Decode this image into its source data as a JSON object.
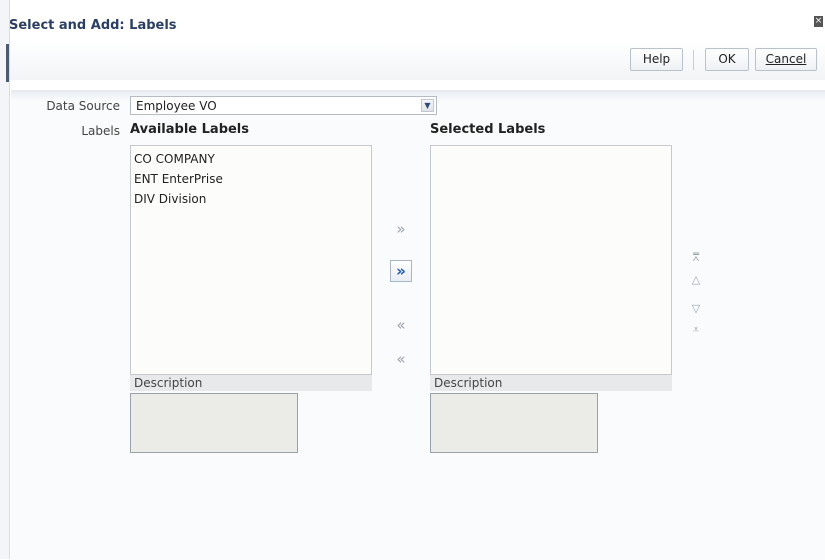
{
  "dialog": {
    "title": "Select and Add: Labels",
    "close_glyph": "×"
  },
  "toolbar": {
    "help_label": "Help",
    "ok_label": "OK",
    "cancel_label": "Cancel"
  },
  "form": {
    "data_source_label": "Data Source",
    "data_source_value": "Employee VO",
    "labels_label": "Labels"
  },
  "available": {
    "heading": "Available Labels",
    "items": [
      "CO COMPANY",
      "ENT EnterPrise",
      "DIV Division"
    ],
    "description_label": "Description"
  },
  "selected": {
    "heading": "Selected Labels",
    "items": [],
    "description_label": "Description"
  },
  "shuttle": {
    "move_glyph": "»",
    "move_all_glyph": "»",
    "remove_glyph": "«",
    "remove_all_glyph": "«"
  },
  "reorder": {
    "top_glyph": "⩞",
    "up_glyph": "△",
    "down_glyph": "▽",
    "bottom_glyph": "⩡"
  },
  "colors": {
    "title": "#2b3f64",
    "accent": "#1c56b5"
  }
}
